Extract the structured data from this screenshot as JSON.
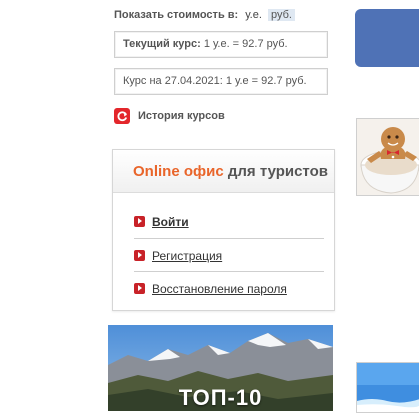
{
  "currency": {
    "label": "Показать стоимость в:",
    "options": [
      "у.е.",
      "руб."
    ],
    "selected": "руб."
  },
  "rates": {
    "current_label": "Текущий курс:",
    "current_value": "1 у.е. = 92.7 руб.",
    "dated": "Курс на 27.04.2021: 1 у.е = 92.7 руб."
  },
  "history": {
    "label": "История курсов",
    "icon": "refresh-icon"
  },
  "office": {
    "title_highlight": "Online офис",
    "title_rest": "для туристов",
    "items": [
      "Войти",
      "Регистрация",
      "Восстановление пароля"
    ]
  },
  "banner": {
    "text": "ТОП-10"
  },
  "colors": {
    "accent_orange": "#e9652a",
    "icon_red": "#c82228",
    "blue_tile": "#4f72b6"
  }
}
